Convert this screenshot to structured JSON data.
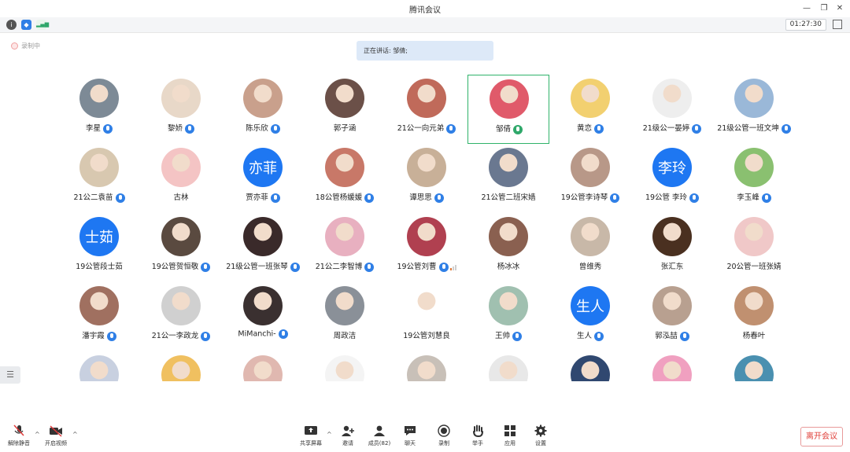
{
  "window": {
    "title": "腾讯会议"
  },
  "status": {
    "timer": "01:27:30",
    "recording_label": "录制中",
    "speaking_label": "正在讲话: 邹倩;"
  },
  "toolbar": {
    "unmute": "解除静音",
    "start_video": "开启视频",
    "share": "共享屏幕",
    "invite": "邀请",
    "members": "成员(82)",
    "chat": "聊天",
    "record": "录制",
    "raise_hand": "举手",
    "apps": "应用",
    "settings": "设置",
    "leave": "离开会议"
  },
  "participants": [
    {
      "name": "李星",
      "mic": "muted",
      "avatar": "photo",
      "color": "#7d8a96"
    },
    {
      "name": "黎娇",
      "mic": "muted",
      "avatar": "photo",
      "color": "#e8d8c8"
    },
    {
      "name": "陈乐欣",
      "mic": "muted",
      "avatar": "photo",
      "color": "#c9a08c"
    },
    {
      "name": "郭子涵",
      "mic": "none",
      "avatar": "photo",
      "color": "#6b5048"
    },
    {
      "name": "21公一向元弟",
      "mic": "muted",
      "avatar": "photo",
      "color": "#c06a5a"
    },
    {
      "name": "邹倩",
      "mic": "talking",
      "avatar": "photo",
      "color": "#e05a6a",
      "active": true
    },
    {
      "name": "黄恋",
      "mic": "muted",
      "avatar": "photo",
      "color": "#f2d070"
    },
    {
      "name": "21级公一晏婷",
      "mic": "muted",
      "avatar": "photo",
      "color": "#eeeeee"
    },
    {
      "name": "21级公管一班文坤",
      "mic": "muted",
      "avatar": "photo",
      "color": "#9ab8d8"
    },
    {
      "name": "21公二袁苗",
      "mic": "muted",
      "avatar": "photo",
      "color": "#d8c8b0"
    },
    {
      "name": "古林",
      "mic": "none",
      "avatar": "photo",
      "color": "#f4c4c4"
    },
    {
      "name": "贾亦菲",
      "mic": "muted",
      "avatar": "text",
      "text": "亦菲"
    },
    {
      "name": "18公管杨媛媛",
      "mic": "muted",
      "avatar": "photo",
      "color": "#c87868"
    },
    {
      "name": "谭思思",
      "mic": "muted",
      "avatar": "photo",
      "color": "#c8b098"
    },
    {
      "name": "21公管二班宋嫱",
      "mic": "none",
      "avatar": "photo",
      "color": "#6a7890"
    },
    {
      "name": "19公管李诗琴",
      "mic": "muted",
      "avatar": "photo",
      "color": "#b89888"
    },
    {
      "name": "19公管 李玲",
      "mic": "muted",
      "avatar": "text",
      "text": "李玲"
    },
    {
      "name": "李玉峰",
      "mic": "muted",
      "avatar": "photo",
      "color": "#8ac070"
    },
    {
      "name": "19公管段士茹",
      "mic": "none",
      "avatar": "text",
      "text": "士茹"
    },
    {
      "name": "19公管贺恒敬",
      "mic": "muted",
      "avatar": "photo",
      "color": "#5a4a40"
    },
    {
      "name": "21级公管一班张琴",
      "mic": "muted",
      "avatar": "photo",
      "color": "#3a2a2a"
    },
    {
      "name": "21公二李智博",
      "mic": "muted",
      "avatar": "photo",
      "color": "#e8b0c0"
    },
    {
      "name": "19公管刘曹",
      "mic": "talking-signal",
      "avatar": "photo",
      "color": "#b04050"
    },
    {
      "name": "杨冰冰",
      "mic": "none",
      "avatar": "photo",
      "color": "#8a6050"
    },
    {
      "name": "曾维秀",
      "mic": "none",
      "avatar": "photo",
      "color": "#c8b8a8"
    },
    {
      "name": "张汇东",
      "mic": "none",
      "avatar": "photo",
      "color": "#4a3020"
    },
    {
      "name": "20公管一班张婧",
      "mic": "none",
      "avatar": "photo",
      "color": "#f0c8c8"
    },
    {
      "name": "潘宇霞",
      "mic": "muted",
      "avatar": "photo",
      "color": "#a07060"
    },
    {
      "name": "21公一李政龙",
      "mic": "muted",
      "avatar": "photo",
      "color": "#d0d0d0"
    },
    {
      "name": "MiManchi-",
      "mic": "muted",
      "avatar": "photo",
      "color": "#3a3030"
    },
    {
      "name": "周政洁",
      "mic": "none",
      "avatar": "photo",
      "color": "#8a9098"
    },
    {
      "name": "19公管刘慧良",
      "mic": "none",
      "avatar": "photo",
      "color": "#ffffff"
    },
    {
      "name": "王帅",
      "mic": "muted",
      "avatar": "photo",
      "color": "#a0c0b0"
    },
    {
      "name": "生人",
      "mic": "muted",
      "avatar": "text",
      "text": "生人"
    },
    {
      "name": "郭泓喆",
      "mic": "muted",
      "avatar": "photo",
      "color": "#b8a090"
    },
    {
      "name": "杨春叶",
      "mic": "none",
      "avatar": "photo",
      "color": "#c09070"
    },
    {
      "name": "",
      "mic": "none",
      "avatar": "photo",
      "color": "#c8d0e0"
    },
    {
      "name": "",
      "mic": "none",
      "avatar": "photo",
      "color": "#f0c060"
    },
    {
      "name": "",
      "mic": "none",
      "avatar": "photo",
      "color": "#e0b8b0"
    },
    {
      "name": "",
      "mic": "none",
      "avatar": "photo",
      "color": "#f4f4f4"
    },
    {
      "name": "",
      "mic": "none",
      "avatar": "photo",
      "color": "#c8c0b8"
    },
    {
      "name": "",
      "mic": "none",
      "avatar": "photo",
      "color": "#e8e8e8"
    },
    {
      "name": "",
      "mic": "none",
      "avatar": "photo",
      "color": "#304870"
    },
    {
      "name": "",
      "mic": "none",
      "avatar": "photo",
      "color": "#f0a0c0"
    },
    {
      "name": "",
      "mic": "none",
      "avatar": "photo",
      "color": "#4a90b0"
    }
  ]
}
